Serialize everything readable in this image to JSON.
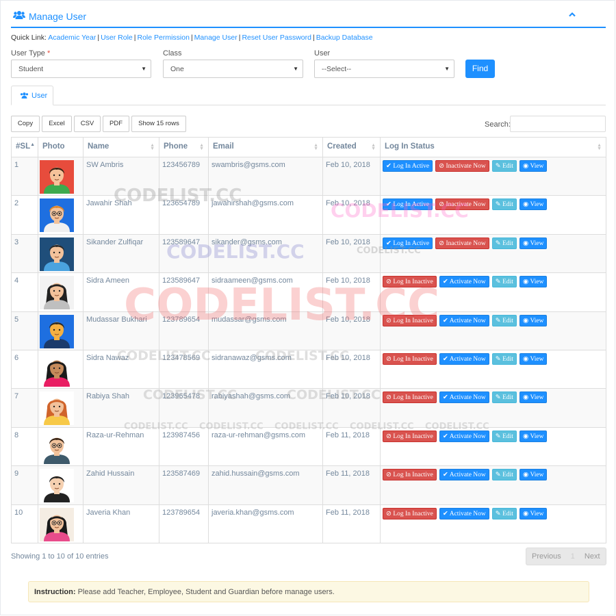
{
  "header": {
    "title": "Manage User",
    "icon": "users-icon",
    "collapse_icon": "chevron-up-icon"
  },
  "quick_links": {
    "label": "Quick Link:",
    "items": [
      "Academic Year",
      "User Role",
      "Role Permission",
      "Manage User",
      "Reset User Password",
      "Backup Database"
    ]
  },
  "filters": {
    "user_type": {
      "label": "User Type",
      "required_mark": "*",
      "value": "Student"
    },
    "class": {
      "label": "Class",
      "value": "One"
    },
    "user": {
      "label": "User",
      "value": "--Select--"
    },
    "find_label": "Find"
  },
  "tabs": [
    {
      "label": "User",
      "icon": "users-icon"
    }
  ],
  "toolbar": {
    "buttons": [
      "Copy",
      "Excel",
      "CSV",
      "PDF",
      "Show 15 rows"
    ],
    "search_label": "Search:"
  },
  "table": {
    "columns": [
      "#SL",
      "Photo",
      "Name",
      "Phone",
      "Email",
      "Created",
      "Log In Status"
    ],
    "sort_asc_glyph": "▲",
    "rows": [
      {
        "sl": "1",
        "name": "SW Ambris",
        "phone": "123456789",
        "email": "swambris@gsms.com",
        "created": "Feb 10, 2018",
        "active": true,
        "avatar": "man-red-bg"
      },
      {
        "sl": "2",
        "name": "Jawahir Shah",
        "phone": "123654789",
        "email": "jawahirshah@gsms.com",
        "created": "Feb 10, 2018",
        "active": true,
        "avatar": "man-glasses-blue-bg"
      },
      {
        "sl": "3",
        "name": "Sikander Zulfiqar",
        "phone": "123589647",
        "email": "sikander@gsms.com",
        "created": "Feb 10, 2018",
        "active": true,
        "avatar": "man-navy-bg"
      },
      {
        "sl": "4",
        "name": "Sidra Ameen",
        "phone": "123589647",
        "email": "sidraameen@gsms.com",
        "created": "Feb 10, 2018",
        "active": false,
        "avatar": "woman-grey"
      },
      {
        "sl": "5",
        "name": "Mudassar Bukhari",
        "phone": "123789654",
        "email": "mudassar@gsms.com",
        "created": "Feb 10, 2018",
        "active": false,
        "avatar": "man-yellow-blue-bg"
      },
      {
        "sl": "6",
        "name": "Sidra Nawaz",
        "phone": "123478569",
        "email": "sidranawaz@gsms.com",
        "created": "Feb 10, 2018",
        "active": false,
        "avatar": "woman-dark-hair"
      },
      {
        "sl": "7",
        "name": "Rabiya Shah",
        "phone": "123965478",
        "email": "rabiyashah@gsms.com",
        "created": "Feb 10, 2018",
        "active": false,
        "avatar": "woman-red-hair"
      },
      {
        "sl": "8",
        "name": "Raza-ur-Rehman",
        "phone": "123987456",
        "email": "raza-ur-rehman@gsms.com",
        "created": "Feb 11, 2018",
        "active": false,
        "avatar": "man-suit-glasses"
      },
      {
        "sl": "9",
        "name": "Zahid Hussain",
        "phone": "123587469",
        "email": "zahid.hussain@gsms.com",
        "created": "Feb 11, 2018",
        "active": false,
        "avatar": "man-suit"
      },
      {
        "sl": "10",
        "name": "Javeria Khan",
        "phone": "123789654",
        "email": "javeria.khan@gsms.com",
        "created": "Feb 11, 2018",
        "active": false,
        "avatar": "woman-glasses"
      }
    ],
    "labels": {
      "log_in_active": "Log In Active",
      "log_in_inactive": "Log In Inactive",
      "inactivate_now": "Inactivate Now",
      "activate_now": "Activate Now",
      "edit": "Edit",
      "view": "View"
    }
  },
  "footer": {
    "info": "Showing 1 to 10 of 10 entries",
    "pager": {
      "previous": "Previous",
      "current": "1",
      "next": "Next"
    }
  },
  "instruction": {
    "label": "Instruction:",
    "text": "Please add Teacher, Employee, Student and Guardian before manage users."
  },
  "watermark": "CODELIST.CC",
  "colors": {
    "primary": "#1E90FF",
    "danger": "#D9534F",
    "info": "#5BC0DE",
    "notice": "#FCF8E3"
  }
}
